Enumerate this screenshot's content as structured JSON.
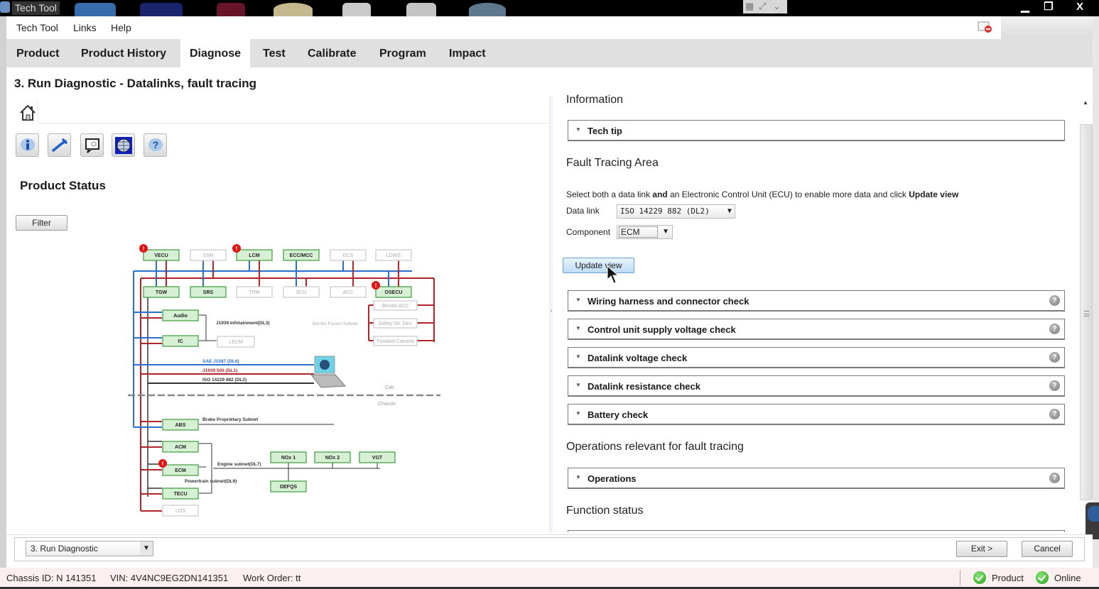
{
  "window": {
    "title": "Tech Tool",
    "controls": {
      "minimize": "▁",
      "maximize": "❐",
      "close": "X"
    }
  },
  "menu": {
    "items": [
      "Tech Tool",
      "Links",
      "Help"
    ],
    "notification_icon": "notification-alert-icon"
  },
  "tabs": [
    {
      "label": "Product",
      "active": false
    },
    {
      "label": "Product History",
      "active": false
    },
    {
      "label": "Diagnose",
      "active": true
    },
    {
      "label": "Test",
      "active": false
    },
    {
      "label": "Calibrate",
      "active": false
    },
    {
      "label": "Program",
      "active": false
    },
    {
      "label": "Impact",
      "active": false
    }
  ],
  "page_title": "3. Run Diagnostic - Datalinks, fault tracing",
  "left": {
    "home_icon": "home-icon",
    "toolbar_icons": [
      "info-icon",
      "wrench-icon",
      "comment-search-icon",
      "globe-icon",
      "help-icon"
    ],
    "product_status_title": "Product Status",
    "filter_label": "Filter",
    "diagram": {
      "modules_top": [
        {
          "name": "VECU",
          "active": true,
          "fault": true
        },
        {
          "name": "SSM",
          "active": false,
          "fault": false
        },
        {
          "name": "LCM",
          "active": true,
          "fault": true
        },
        {
          "name": "ECC/MCC",
          "active": true,
          "fault": false
        },
        {
          "name": "ECS",
          "active": false,
          "fault": false
        },
        {
          "name": "LDWS",
          "active": false,
          "fault": false
        }
      ],
      "modules_second": [
        {
          "name": "TGW",
          "active": true,
          "fault": false
        },
        {
          "name": "SRS",
          "active": true,
          "fault": false
        },
        {
          "name": "TPM",
          "active": false,
          "fault": false
        },
        {
          "name": "SCU",
          "active": false,
          "fault": false
        },
        {
          "name": "ACC",
          "active": false,
          "fault": false
        },
        {
          "name": "OSECU",
          "active": true,
          "fault": true
        }
      ],
      "modules_left": [
        {
          "name": "Audio",
          "active": true
        },
        {
          "name": "IC",
          "active": true
        }
      ],
      "lecm": "LECM",
      "infotainment_label": "J1939 Infotainment(DL3)",
      "bendix_subnet_label": "Bendix Fusion Subnet",
      "bendix_modules": [
        "Bendix ACC",
        "Safety Dir. Dev.",
        "Forward Camera"
      ],
      "datalinks": [
        {
          "label": "SAE J1587 (DL6)",
          "color": "#2a6fd0"
        },
        {
          "label": "J1939 500 (DL1)",
          "color": "#b0242a"
        },
        {
          "label": "ISO 14229 882 (DL2)",
          "color": "#333333"
        }
      ],
      "cab_label": "Cab",
      "chassis_label": "Chassis",
      "abs": "ABS",
      "brake_subnet_label": "Brake Proprietary Subnet",
      "engine_modules": [
        {
          "name": "ACM",
          "fault": false
        },
        {
          "name": "ECM",
          "fault": true
        },
        {
          "name": "TECU",
          "fault": false
        }
      ],
      "los": "LOS",
      "engine_subnet_label": "Engine subnet(DL7)",
      "powertrain_subnet_label": "Powertrain subnet(DL9)",
      "sensors": [
        "NOx 1",
        "NOx 2",
        "VGT"
      ],
      "defqs": "DEFQS",
      "colors": {
        "active_fill": "#d6f0d4",
        "active_border": "#3e9a3b",
        "can_blue": "#2a6fd0",
        "can_red": "#b0242a",
        "fault_red": "#e01515"
      }
    }
  },
  "right": {
    "information_title": "Information",
    "tech_tip_label": "Tech tip",
    "fault_tracing_title": "Fault Tracing Area",
    "description_parts": [
      "Select both a data link ",
      "and",
      " an Electronic Control Unit (ECU) to enable more data and click ",
      "Update view"
    ],
    "data_link_label": "Data link",
    "data_link_value": "ISO 14229 882 (DL2)",
    "component_label": "Component",
    "component_value": "ECM",
    "update_view_label": "Update view",
    "checks": [
      "Wiring harness and connector check",
      "Control unit supply voltage check",
      "Datalink voltage check",
      "Datalink resistance check",
      "Battery check"
    ],
    "operations_title": "Operations relevant for fault tracing",
    "operations_label": "Operations",
    "function_status_title": "Function status"
  },
  "bottom": {
    "step_select_value": "3. Run Diagnostic",
    "exit_label": "Exit >",
    "cancel_label": "Cancel"
  },
  "status": {
    "chassis_id": "Chassis ID: N 141351",
    "vin": "VIN: 4V4NC9EG2DN141351",
    "work_order": "Work Order: tt",
    "product_label": "Product",
    "online_label": "Online"
  }
}
